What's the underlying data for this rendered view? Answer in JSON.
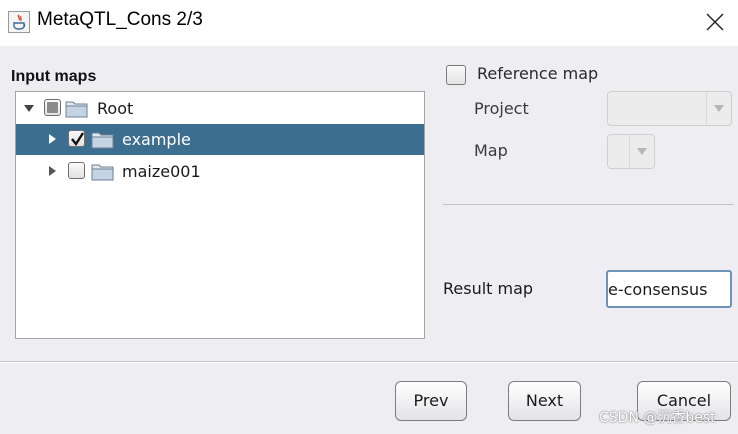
{
  "window": {
    "title": "MetaQTL_Cons 2/3",
    "close_symbol": "✕"
  },
  "input_maps": {
    "label": "Input maps",
    "tree": [
      {
        "label": "Root",
        "level": 0,
        "expanded": true,
        "check_state": "partial",
        "selected": false
      },
      {
        "label": "example",
        "level": 1,
        "expanded": false,
        "check_state": "checked",
        "selected": true
      },
      {
        "label": "maize001",
        "level": 1,
        "expanded": false,
        "check_state": "unchecked",
        "selected": false
      }
    ]
  },
  "reference_map": {
    "label": "Reference map",
    "checked": false,
    "project_label": "Project",
    "project_value": "",
    "map_label": "Map",
    "map_value": ""
  },
  "result_map": {
    "label": "Result map",
    "value": "e-consensus"
  },
  "buttons": {
    "prev": "Prev",
    "next": "Next",
    "cancel": "Cancel"
  },
  "watermark": "CSDN @沉香best",
  "colors": {
    "selection": "#3c6e8f",
    "focus_border": "#6e93b8",
    "panel_background": "#eeeef2"
  },
  "icons": [
    "java-app-icon",
    "close-icon",
    "expand-arrow-icon",
    "collapse-arrow-icon",
    "folder-icon",
    "checkmark-icon",
    "dropdown-arrow-icon"
  ]
}
